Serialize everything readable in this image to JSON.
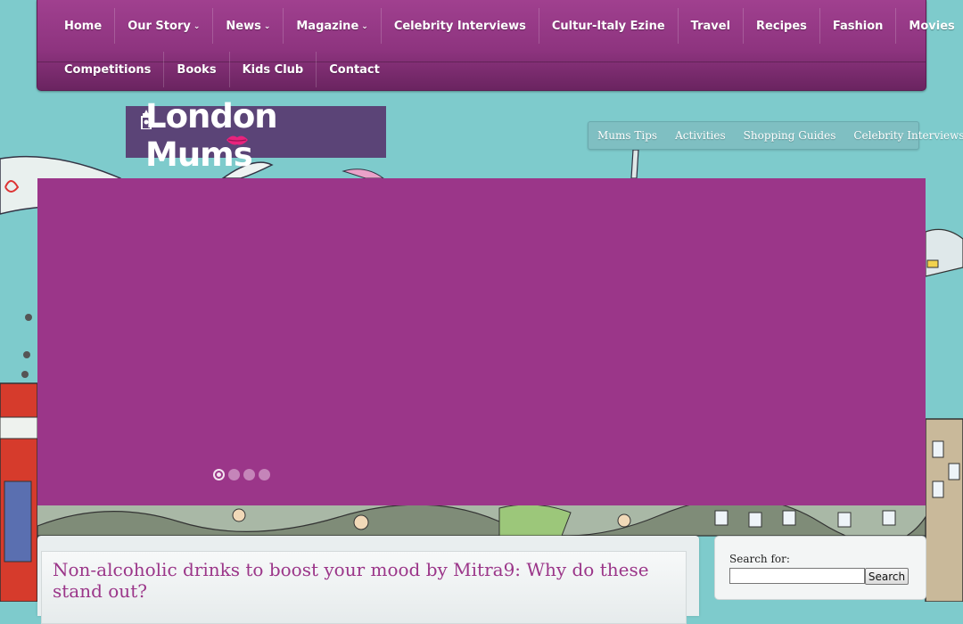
{
  "nav": {
    "row1": [
      {
        "label": "Home",
        "dropdown": false
      },
      {
        "label": "Our Story",
        "dropdown": true
      },
      {
        "label": "News",
        "dropdown": true
      },
      {
        "label": "Magazine",
        "dropdown": true
      },
      {
        "label": "Celebrity Interviews",
        "dropdown": false
      },
      {
        "label": "Cultur-Italy Ezine",
        "dropdown": false
      },
      {
        "label": "Travel",
        "dropdown": false
      },
      {
        "label": "Recipes",
        "dropdown": false
      },
      {
        "label": "Fashion",
        "dropdown": false
      },
      {
        "label": "Movies",
        "dropdown": false
      }
    ],
    "row2": [
      {
        "label": "Competitions"
      },
      {
        "label": "Books"
      },
      {
        "label": "Kids Club"
      },
      {
        "label": "Contact"
      }
    ],
    "dropdown_icon": "chevron-down-icon"
  },
  "logo": {
    "text": "London Mums",
    "icon": "big-ben-icon",
    "lips_icon": "pink-lips-icon"
  },
  "subnav": {
    "items": [
      "Mums Tips",
      "Activities",
      "Shopping Guides",
      "Celebrity Interviews"
    ]
  },
  "slider": {
    "slide_count": 4,
    "active_index": 0
  },
  "post": {
    "title": "Non-alcoholic drinks to boost your mood by Mitra9: Why do these stand out?"
  },
  "search": {
    "label": "Search for:",
    "input_value": "",
    "button_label": "Search"
  },
  "colors": {
    "brand_purple": "#9b3689",
    "nav_purple": "#8e347f",
    "background_teal": "#7ecbcc",
    "logo_bg": "#5b4477",
    "lips_pink": "#e8237d"
  }
}
